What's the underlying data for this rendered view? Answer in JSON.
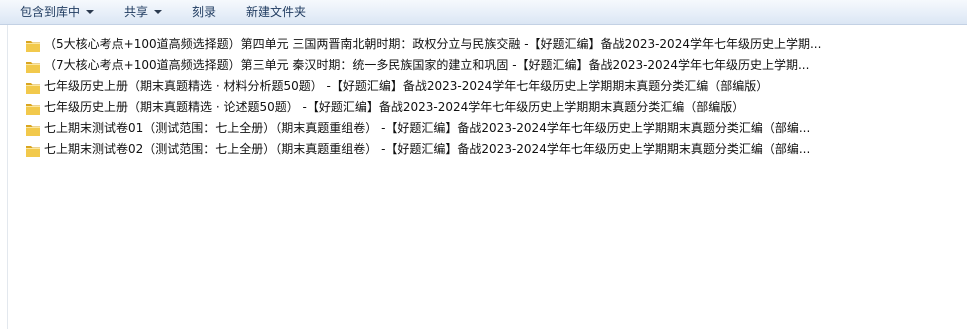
{
  "toolbar": {
    "include_library_label": "包含到库中",
    "share_label": "共享",
    "burn_label": "刻录",
    "new_folder_label": "新建文件夹"
  },
  "file_list": {
    "items": [
      {
        "name": "（5大核心考点+100道高频选择题）第四单元  三国两晋南北朝时期：政权分立与民族交融 -【好题汇编】备战2023-2024学年七年级历史上学期...",
        "icon": "folder-icon"
      },
      {
        "name": "（7大核心考点+100道高频选择题）第三单元  秦汉时期：统一多民族国家的建立和巩固 -【好题汇编】备战2023-2024学年七年级历史上学期...",
        "icon": "folder-icon"
      },
      {
        "name": "七年级历史上册（期末真题精选 · 材料分析题50题） -【好题汇编】备战2023-2024学年七年级历史上学期期末真题分类汇编（部编版）",
        "icon": "folder-icon"
      },
      {
        "name": "七年级历史上册（期末真题精选 · 论述题50题） -【好题汇编】备战2023-2024学年七年级历史上学期期末真题分类汇编（部编版）",
        "icon": "folder-icon"
      },
      {
        "name": "七上期末测试卷01（测试范围：七上全册）（期末真题重组卷） -【好题汇编】备战2023-2024学年七年级历史上学期期末真题分类汇编（部编...",
        "icon": "folder-icon"
      },
      {
        "name": "七上期末测试卷02（测试范围：七上全册）（期末真题重组卷） -【好题汇编】备战2023-2024学年七年级历史上学期期末真题分类汇编（部编...",
        "icon": "folder-icon"
      }
    ]
  },
  "colors": {
    "toolbar_text": "#1e3a5f",
    "folder_fill": "#f2c94c",
    "folder_dark": "#d9a520"
  }
}
